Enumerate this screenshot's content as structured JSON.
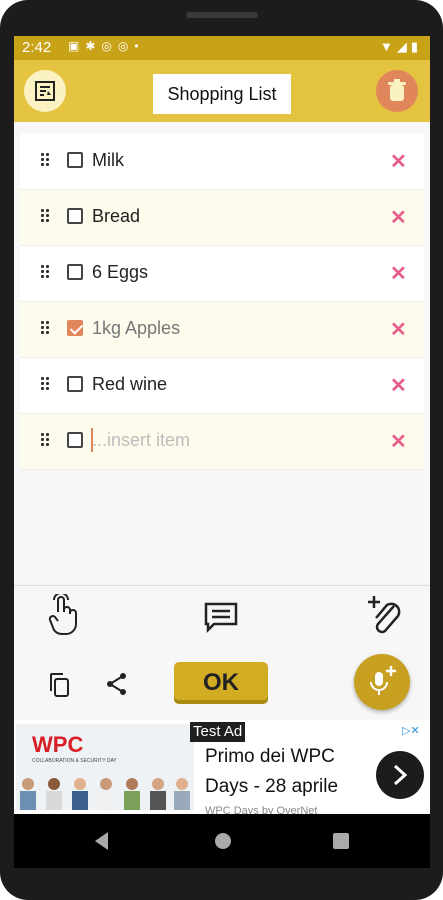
{
  "status_bar": {
    "time": "2:42"
  },
  "app_bar": {
    "title": "Shopping List",
    "left_icon": "sort-list-icon",
    "right_icon": "trash-icon"
  },
  "items": [
    {
      "label": "Milk",
      "checked": false
    },
    {
      "label": "Bread",
      "checked": false
    },
    {
      "label": "6 Eggs",
      "checked": false
    },
    {
      "label": "1kg Apples",
      "checked": true
    },
    {
      "label": "Red wine",
      "checked": false
    }
  ],
  "new_item": {
    "placeholder": "...insert item"
  },
  "toolbar": {
    "ok_label": "OK",
    "icons": [
      "touch-gesture-icon",
      "message-icon",
      "attachment-add-icon",
      "copy-icon",
      "share-icon",
      "mic-add-icon"
    ]
  },
  "ad": {
    "badge": "Test Ad",
    "brand": "WPC",
    "brand_sub": "COLLABORATION & SECURITY DAY",
    "headline": "Primo dei WPC Days - 28 aprile",
    "subtitle": "WPC Days by OverNet"
  },
  "colors": {
    "accent": "#e3c33f",
    "checkbox_checked": "#e0865a",
    "delete": "#e55f8a",
    "ok_button": "#d2ad23"
  }
}
